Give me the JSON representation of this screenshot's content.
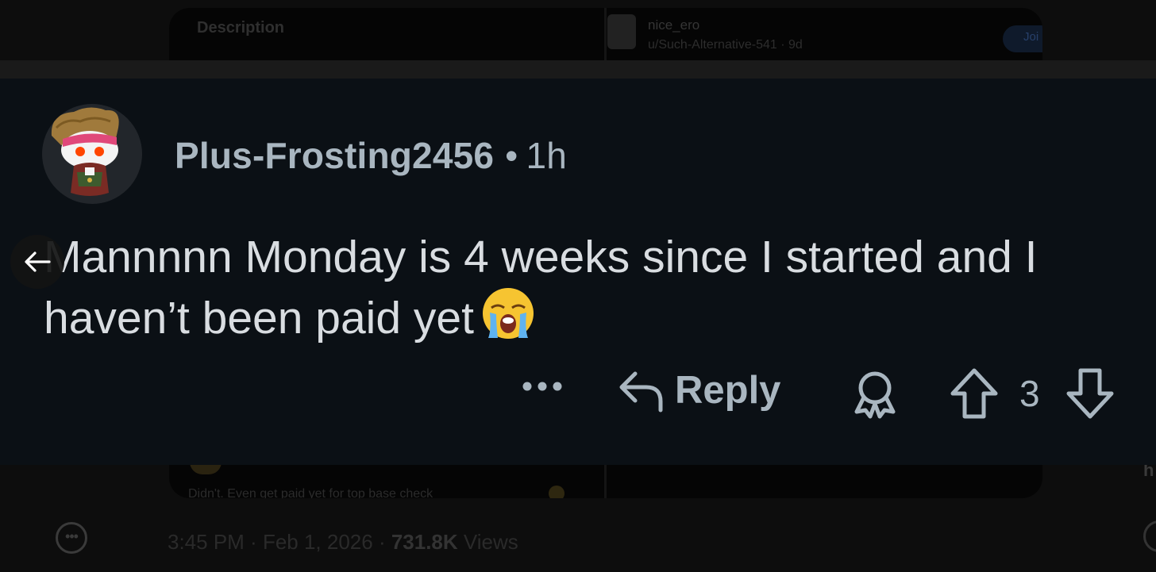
{
  "background": {
    "card_top": {
      "description_label": "Description",
      "right_username": "nice_ero",
      "right_subline": "u/Such-Alternative-541 · 9d",
      "join_label": "Joi"
    },
    "card_bottom": {
      "preview_text": "Didn't. Even get paid yet for top base check"
    },
    "meta": {
      "time": "3:45 PM",
      "date": "Feb 1, 2026",
      "views_count": "731.8K",
      "views_label": "Views"
    },
    "right_edge_letter": "h"
  },
  "comment": {
    "username": "Plus-Frosting2456",
    "separator": "•",
    "age": "1h",
    "body": "Mannnnn Monday is 4 weeks since I started and I haven’t been paid yet",
    "emoji": "loudly-crying-face",
    "actions": {
      "more": "•••",
      "reply_label": "Reply",
      "vote_count": "3"
    }
  },
  "icons": [
    "back-arrow-icon",
    "more-dots-icon",
    "reply-arrow-icon",
    "award-icon",
    "upvote-arrow-icon",
    "downvote-arrow-icon",
    "crying-face-emoji"
  ],
  "colors": {
    "card_bg": "#0b1015",
    "meta_text": "#a9b6c0",
    "body_text": "#d9dde1"
  }
}
